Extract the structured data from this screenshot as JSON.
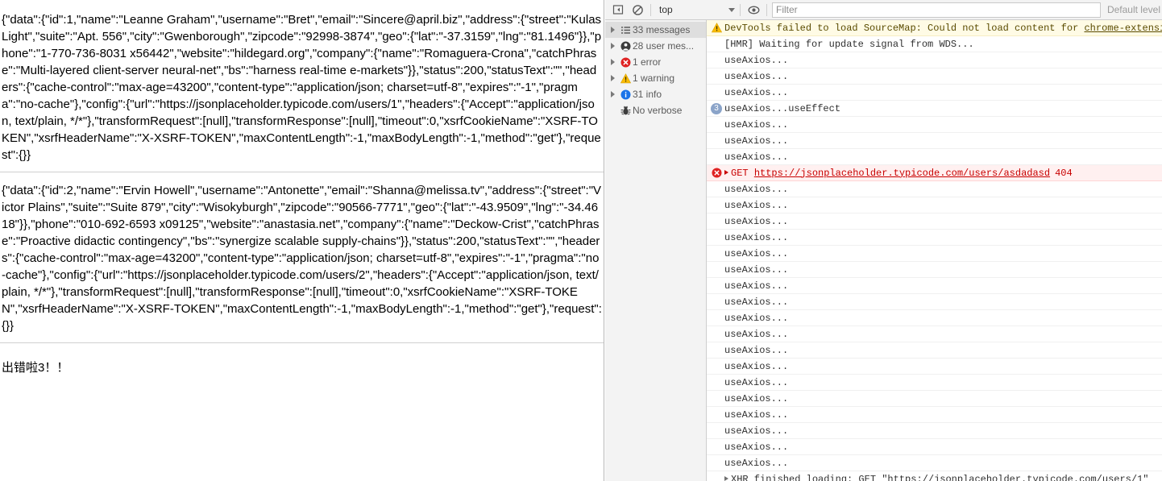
{
  "page": {
    "blocks": [
      "{\"data\":{\"id\":1,\"name\":\"Leanne Graham\",\"username\":\"Bret\",\"email\":\"Sincere@april.biz\",\"address\":{\"street\":\"Kulas Light\",\"suite\":\"Apt. 556\",\"city\":\"Gwenborough\",\"zipcode\":\"92998-3874\",\"geo\":{\"lat\":\"-37.3159\",\"lng\":\"81.1496\"}},\"phone\":\"1-770-736-8031 x56442\",\"website\":\"hildegard.org\",\"company\":{\"name\":\"Romaguera-Crona\",\"catchPhrase\":\"Multi-layered client-server neural-net\",\"bs\":\"harness real-time e-markets\"}},\"status\":200,\"statusText\":\"\",\"headers\":{\"cache-control\":\"max-age=43200\",\"content-type\":\"application/json; charset=utf-8\",\"expires\":\"-1\",\"pragma\":\"no-cache\"},\"config\":{\"url\":\"https://jsonplaceholder.typicode.com/users/1\",\"headers\":{\"Accept\":\"application/json, text/plain, */*\"},\"transformRequest\":[null],\"transformResponse\":[null],\"timeout\":0,\"xsrfCookieName\":\"XSRF-TOKEN\",\"xsrfHeaderName\":\"X-XSRF-TOKEN\",\"maxContentLength\":-1,\"maxBodyLength\":-1,\"method\":\"get\"},\"request\":{}}",
      "{\"data\":{\"id\":2,\"name\":\"Ervin Howell\",\"username\":\"Antonette\",\"email\":\"Shanna@melissa.tv\",\"address\":{\"street\":\"Victor Plains\",\"suite\":\"Suite 879\",\"city\":\"Wisokyburgh\",\"zipcode\":\"90566-7771\",\"geo\":{\"lat\":\"-43.9509\",\"lng\":\"-34.4618\"}},\"phone\":\"010-692-6593 x09125\",\"website\":\"anastasia.net\",\"company\":{\"name\":\"Deckow-Crist\",\"catchPhrase\":\"Proactive didactic contingency\",\"bs\":\"synergize scalable supply-chains\"}},\"status\":200,\"statusText\":\"\",\"headers\":{\"cache-control\":\"max-age=43200\",\"content-type\":\"application/json; charset=utf-8\",\"expires\":\"-1\",\"pragma\":\"no-cache\"},\"config\":{\"url\":\"https://jsonplaceholder.typicode.com/users/2\",\"headers\":{\"Accept\":\"application/json, text/plain, */*\"},\"transformRequest\":[null],\"transformResponse\":[null],\"timeout\":0,\"xsrfCookieName\":\"XSRF-TOKEN\",\"xsrfHeaderName\":\"X-XSRF-TOKEN\",\"maxContentLength\":-1,\"maxBodyLength\":-1,\"method\":\"get\"},\"request\":{}}"
    ],
    "error_message": "出错啦3！！"
  },
  "devtools": {
    "toolbar": {
      "sidebar_toggle_icon": "show-console-sidebar-icon",
      "clear_icon": "clear-console-icon",
      "context_label": "top",
      "eye_icon": "live-expression-icon",
      "filter_placeholder": "Filter",
      "filter_value": "",
      "level_label": "Default level"
    },
    "sidebar": [
      {
        "icon": "list-icon",
        "label": "33 messages",
        "selected": true
      },
      {
        "icon": "user-icon",
        "label": "28 user mes...",
        "selected": false
      },
      {
        "icon": "error-icon",
        "label": "1 error",
        "selected": false
      },
      {
        "icon": "warning-icon",
        "label": "1 warning",
        "selected": false
      },
      {
        "icon": "info-icon",
        "label": "31 info",
        "selected": false
      },
      {
        "icon": "bug-icon",
        "label": "No verbose",
        "selected": false,
        "no_triangle": true
      }
    ],
    "log_rows": [
      {
        "level": "warning",
        "gutter": "warning-icon",
        "text": "DevTools failed to load SourceMap: Could not load content for ",
        "link": "chrome-extension://n"
      },
      {
        "level": "log",
        "text": "[HMR] Waiting for update signal from WDS..."
      },
      {
        "level": "log",
        "text": "useAxios..."
      },
      {
        "level": "log",
        "text": "useAxios..."
      },
      {
        "level": "log",
        "text": "useAxios..."
      },
      {
        "level": "log",
        "gutter": "count-badge",
        "badge": "3",
        "text": "useAxios...useEffect"
      },
      {
        "level": "log",
        "text": "useAxios..."
      },
      {
        "level": "log",
        "text": "useAxios..."
      },
      {
        "level": "log",
        "text": "useAxios..."
      },
      {
        "level": "error",
        "gutter": "error-icon",
        "expandable": true,
        "method": "GET",
        "link": "https://jsonplaceholder.typicode.com/users/asdadasd",
        "status": "404"
      },
      {
        "level": "log",
        "text": "useAxios..."
      },
      {
        "level": "log",
        "text": "useAxios..."
      },
      {
        "level": "log",
        "text": "useAxios..."
      },
      {
        "level": "log",
        "text": "useAxios..."
      },
      {
        "level": "log",
        "text": "useAxios..."
      },
      {
        "level": "log",
        "text": "useAxios..."
      },
      {
        "level": "log",
        "text": "useAxios..."
      },
      {
        "level": "log",
        "text": "useAxios..."
      },
      {
        "level": "log",
        "text": "useAxios..."
      },
      {
        "level": "log",
        "text": "useAxios..."
      },
      {
        "level": "log",
        "text": "useAxios..."
      },
      {
        "level": "log",
        "text": "useAxios..."
      },
      {
        "level": "log",
        "text": "useAxios..."
      },
      {
        "level": "log",
        "text": "useAxios..."
      },
      {
        "level": "log",
        "text": "useAxios..."
      },
      {
        "level": "log",
        "text": "useAxios..."
      },
      {
        "level": "log",
        "text": "useAxios..."
      },
      {
        "level": "log",
        "text": "useAxios..."
      },
      {
        "level": "log",
        "expandable": true,
        "text": "XHR finished loading: GET \"https://jsonplaceholder.typicode.com/users/1\""
      }
    ]
  }
}
